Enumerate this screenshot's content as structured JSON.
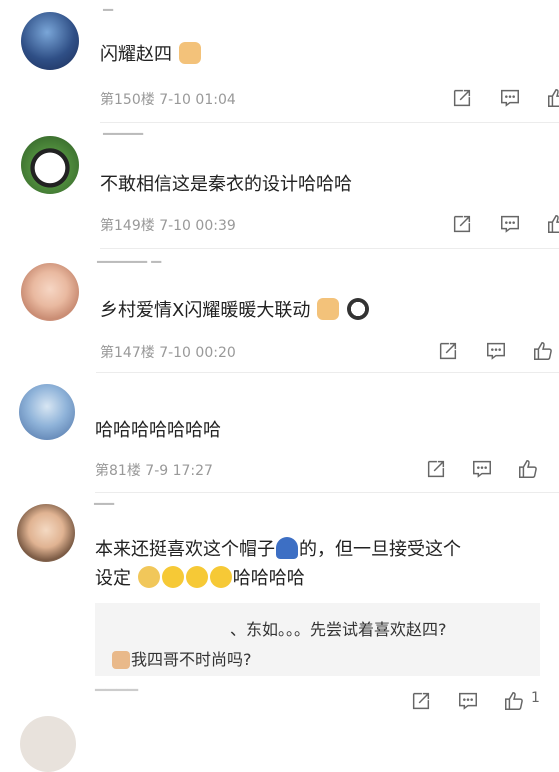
{
  "comments": [
    {
      "text": "闪耀赵四",
      "floor": "第150楼",
      "time": "7-10 01:04"
    },
    {
      "text": "不敢相信这是秦衣的设计哈哈哈",
      "floor": "第149楼",
      "time": "7-10 00:39"
    },
    {
      "text": "乡村爱情X闪耀暖暖大联动",
      "floor": "第147楼",
      "time": "7-10 00:20"
    },
    {
      "text": "哈哈哈哈哈哈哈",
      "floor": "第81楼",
      "time": "7-9 17:27"
    },
    {
      "text_line1_a": "本来还挺喜欢这个帽子",
      "text_line1_b": "的，但一旦接受这个",
      "text_line2_a": "设定",
      "text_line2_b": "哈哈哈哈",
      "like_count": "1"
    }
  ],
  "reply": {
    "line1": "、东如。。。先尝试着喜欢赵四?",
    "line2": "我四哥不时尚吗?"
  },
  "icons": {
    "share": "share-icon",
    "reply": "comment-icon",
    "like": "thumbs-up-icon"
  },
  "colors": {
    "text": "#222222",
    "meta": "#999999",
    "reply_bg": "#f4f4f4"
  }
}
